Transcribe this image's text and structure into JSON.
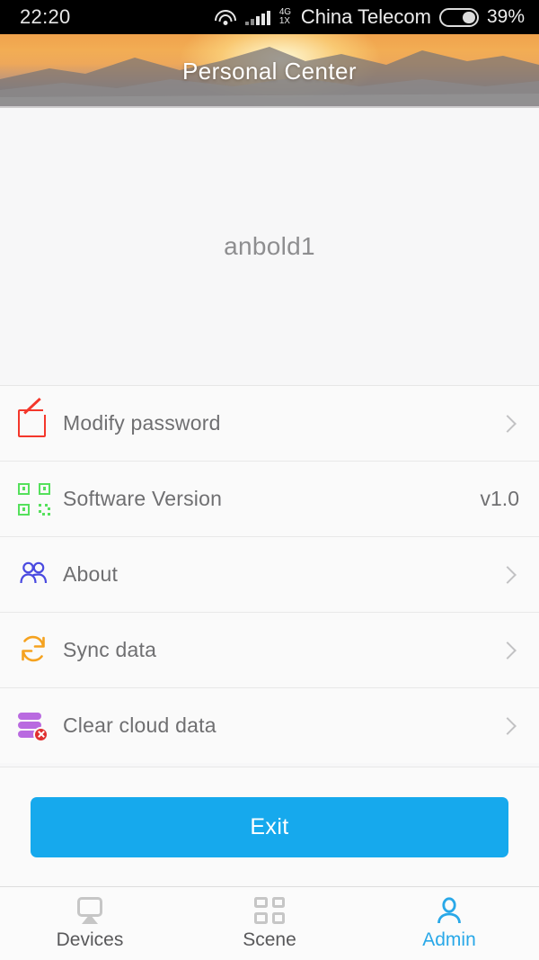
{
  "statusbar": {
    "time": "22:20",
    "wifi_icon": "wifi-icon",
    "signal_icon": "cellular-signal-icon",
    "network_type_primary": "4G",
    "network_type_secondary": "1X",
    "carrier": "China  Telecom",
    "battery_icon": "battery-icon",
    "battery_percent": "39%",
    "battery_level": 39
  },
  "header": {
    "title": "Personal Center",
    "background": "sunset-mountains-banner"
  },
  "profile": {
    "username": "anbold1"
  },
  "menu": {
    "items": [
      {
        "id": "modify-password",
        "label": "Modify password",
        "icon": "edit-pencil-square-icon",
        "icon_color": "#f4372b",
        "value": "",
        "has_chevron": true
      },
      {
        "id": "software-version",
        "label": "Software Version",
        "icon": "qr-code-icon",
        "icon_color": "#55e05c",
        "value": "v1.0",
        "has_chevron": false
      },
      {
        "id": "about",
        "label": "About",
        "icon": "users-group-icon",
        "icon_color": "#4a4ae0",
        "value": "",
        "has_chevron": true
      },
      {
        "id": "sync-data",
        "label": "Sync data",
        "icon": "sync-refresh-icon",
        "icon_color": "#f5a21f",
        "value": "",
        "has_chevron": true
      },
      {
        "id": "clear-cloud-data",
        "label": "Clear cloud data",
        "icon": "database-delete-icon",
        "icon_color": "#b96ae0",
        "value": "",
        "has_chevron": true
      }
    ]
  },
  "actions": {
    "exit_label": "Exit",
    "exit_color": "#16a9ed"
  },
  "tabbar": {
    "active_color": "#29a8e8",
    "inactive_color": "#58585a",
    "tabs": [
      {
        "id": "devices",
        "label": "Devices",
        "icon": "screen-cast-icon",
        "active": false
      },
      {
        "id": "scene",
        "label": "Scene",
        "icon": "grid-squares-icon",
        "active": false
      },
      {
        "id": "admin",
        "label": "Admin",
        "icon": "person-icon",
        "active": true
      }
    ]
  }
}
